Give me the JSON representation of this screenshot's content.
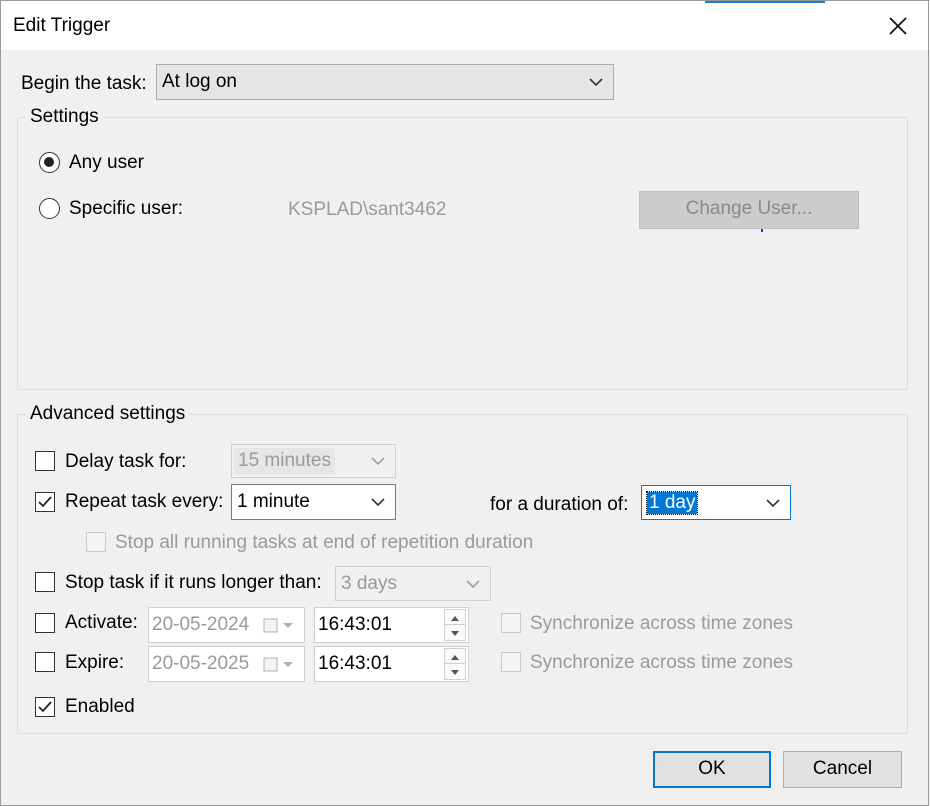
{
  "window": {
    "title": "Edit Trigger"
  },
  "begin": {
    "label": "Begin the task:",
    "value": "At log on"
  },
  "settings": {
    "legend": "Settings",
    "any_user": "Any user",
    "specific_user": "Specific user:",
    "user_name": "KSPLAD\\sant3462",
    "change_user": "Change User..."
  },
  "advanced": {
    "legend": "Advanced settings",
    "delay": {
      "label": "Delay task for:",
      "value": "15 minutes",
      "checked": false
    },
    "repeat": {
      "label": "Repeat task every:",
      "value": "1 minute",
      "checked": true
    },
    "duration": {
      "label": "for a duration of:",
      "value": "1 day"
    },
    "stop_running": {
      "label": "Stop all running tasks at end of repetition duration",
      "checked": false
    },
    "stop_longer": {
      "label": "Stop task if it runs longer than:",
      "value": "3 days",
      "checked": false
    },
    "activate": {
      "label": "Activate:",
      "date": "20-05-2024",
      "time": "16:43:01",
      "sync": "Synchronize across time zones",
      "checked": false
    },
    "expire": {
      "label": "Expire:",
      "date": "20-05-2025",
      "time": "16:43:01",
      "sync": "Synchronize across time zones",
      "checked": false
    },
    "enabled": {
      "label": "Enabled",
      "checked": true
    }
  },
  "buttons": {
    "ok": "OK",
    "cancel": "Cancel"
  },
  "colors": {
    "accent": "#0078d7",
    "disabled_text": "#9a9a9a"
  }
}
